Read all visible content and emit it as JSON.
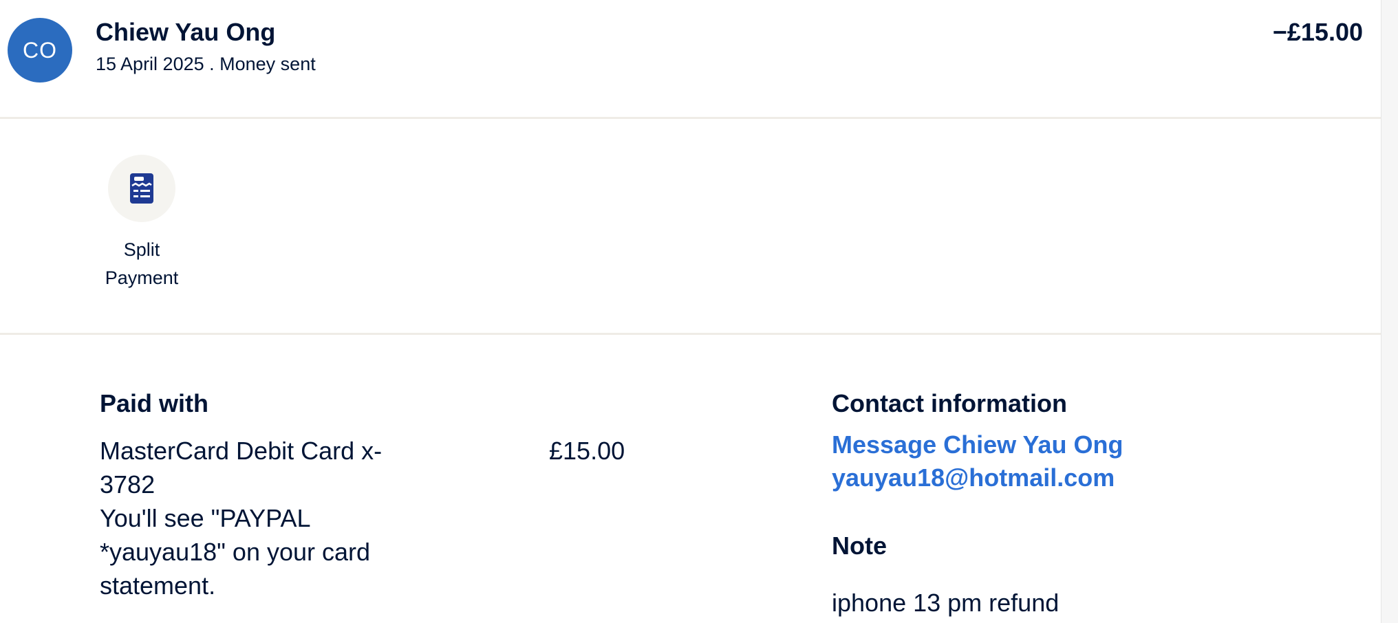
{
  "header": {
    "avatar_initials": "CO",
    "name": "Chiew Yau Ong",
    "date": "15 April 2025",
    "separator": " . ",
    "type": "Money sent",
    "amount": "−£15.00"
  },
  "actions": [
    {
      "label_line1": "Split",
      "label_line2": "Payment",
      "icon": "receipt-icon"
    }
  ],
  "paid_with": {
    "title": "Paid with",
    "card_line1": "MasterCard Debit Card x-",
    "card_line2": "3782",
    "statement_line1": "You'll see \"PAYPAL",
    "statement_line2": "*yauyau18\" on your card",
    "statement_line3": "statement.",
    "amount": "£15.00"
  },
  "contact": {
    "title": "Contact information",
    "message_link": "Message Chiew Yau Ong",
    "email": "yauyau18@hotmail.com"
  },
  "note": {
    "title": "Note",
    "text": "iphone 13 pm refund"
  },
  "colors": {
    "avatar": "#2b6cbf",
    "link": "#2a6fd6",
    "text": "#001435",
    "icon": "#1f3a93"
  }
}
